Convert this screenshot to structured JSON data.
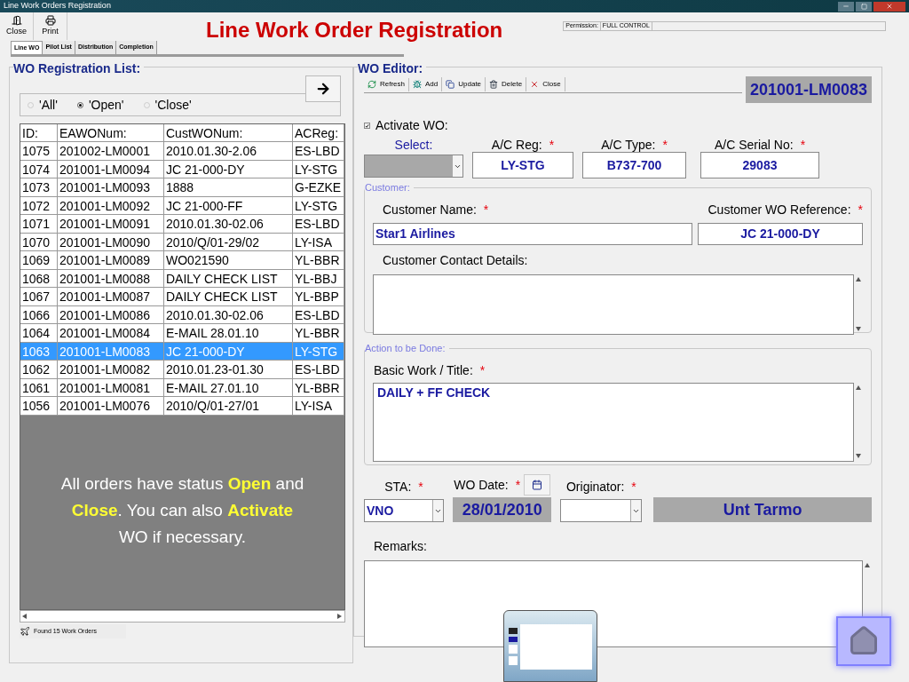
{
  "window": {
    "title": "Line Work Orders Registration"
  },
  "toolbar": [
    {
      "label": "Close",
      "kind": "close"
    },
    {
      "label": "Print",
      "kind": "print"
    }
  ],
  "page_title": "Line Work Order Registration",
  "permission": {
    "label": "Permission:",
    "value": "FULL CONTROL"
  },
  "tabs": [
    {
      "label": "Line WO",
      "selected": true
    },
    {
      "label": "Pilot List",
      "selected": false
    },
    {
      "label": "Distribution",
      "selected": false
    },
    {
      "label": "Completion",
      "selected": false
    }
  ],
  "list_panel": {
    "title": "WO Registration List:",
    "filters": [
      {
        "label": "'All'",
        "selected": false
      },
      {
        "label": "'Open'",
        "selected": true
      },
      {
        "label": "'Close'",
        "selected": false
      }
    ],
    "columns": [
      "ID:",
      "EAWONum:",
      "CustWONum:",
      "ACReg:"
    ],
    "rows": [
      {
        "cells": [
          "1075",
          "201002-LM0001",
          "2010.01.30-2.06",
          "ES-LBD"
        ],
        "selected": false
      },
      {
        "cells": [
          "1074",
          "201001-LM0094",
          "JC 21-000-DY",
          "LY-STG"
        ],
        "selected": false
      },
      {
        "cells": [
          "1073",
          "201001-LM0093",
          "1888",
          "G-EZKE"
        ],
        "selected": false
      },
      {
        "cells": [
          "1072",
          "201001-LM0092",
          "JC 21-000-FF",
          "LY-STG"
        ],
        "selected": false
      },
      {
        "cells": [
          "1071",
          "201001-LM0091",
          "2010.01.30-02.06",
          "ES-LBD"
        ],
        "selected": false
      },
      {
        "cells": [
          "1070",
          "201001-LM0090",
          "2010/Q/01-29/02",
          "LY-ISA"
        ],
        "selected": false
      },
      {
        "cells": [
          "1069",
          "201001-LM0089",
          "WO021590",
          "YL-BBR"
        ],
        "selected": false
      },
      {
        "cells": [
          "1068",
          "201001-LM0088",
          "DAILY CHECK LIST",
          "YL-BBJ"
        ],
        "selected": false
      },
      {
        "cells": [
          "1067",
          "201001-LM0087",
          "DAILY CHECK LIST",
          "YL-BBP"
        ],
        "selected": false
      },
      {
        "cells": [
          "1066",
          "201001-LM0086",
          "2010.01.30-02.06",
          "ES-LBD"
        ],
        "selected": false
      },
      {
        "cells": [
          "1064",
          "201001-LM0084",
          "E-MAIL 28.01.10",
          "YL-BBR"
        ],
        "selected": false
      },
      {
        "cells": [
          "1063",
          "201001-LM0083",
          "JC 21-000-DY",
          "LY-STG"
        ],
        "selected": true
      },
      {
        "cells": [
          "1062",
          "201001-LM0082",
          "2010.01.23-01.30",
          "ES-LBD"
        ],
        "selected": false
      },
      {
        "cells": [
          "1061",
          "201001-LM0081",
          "E-MAIL 27.01.10",
          "YL-BBR"
        ],
        "selected": false
      },
      {
        "cells": [
          "1056",
          "201001-LM0076",
          "2010/Q/01-27/01",
          "LY-ISA"
        ],
        "selected": false
      }
    ],
    "status": "Found 15 Work Orders"
  },
  "note": "All orders have status **Open** and **Close**. You can also **Activate** WO if necessary.",
  "editor": {
    "title": "WO Editor:",
    "toolbar": [
      {
        "label": "Refresh",
        "kind": "refresh"
      },
      {
        "label": "Add",
        "kind": "add"
      },
      {
        "label": "Update",
        "kind": "update"
      },
      {
        "label": "Delete",
        "kind": "delete"
      },
      {
        "label": "Close",
        "kind": "close"
      }
    ],
    "wo_number": "201001-LM0083",
    "activate": {
      "label": "Activate WO:",
      "checked": true
    },
    "aircraft": [
      {
        "label": "Select:",
        "kind": "combo"
      },
      {
        "label": "A/C Reg:",
        "mark": "*",
        "kind": "text",
        "value": "LY-STG"
      },
      {
        "label": "A/C Type:",
        "mark": "*",
        "kind": "text",
        "value": "B737-700"
      },
      {
        "label": "A/C Serial No:",
        "mark": "*",
        "kind": "text",
        "value": "29083"
      }
    ],
    "customer": {
      "title": "Customer:",
      "name": {
        "label": "Customer Name:",
        "mark": "*",
        "value": "Star1 Airlines"
      },
      "reference": {
        "label": "Customer WO Reference:",
        "mark": "*",
        "value": "JC 21-000-DY"
      },
      "contact": {
        "label": "Customer Contact Details:"
      }
    },
    "action": {
      "title": "Action to be Done:",
      "work": {
        "label": "Basic Work / Title:",
        "mark": "*",
        "value": "DAILY + FF CHECK"
      }
    },
    "sta": {
      "label": "STA:",
      "mark": "*",
      "value": "VNO"
    },
    "wo_date": {
      "label": "WO Date:",
      "mark": "*",
      "value": "28/01/2010"
    },
    "originator": {
      "label": "Originator:",
      "mark": "*",
      "name": "Unt Tarmo"
    },
    "remarks": {
      "label": "Remarks:"
    }
  }
}
